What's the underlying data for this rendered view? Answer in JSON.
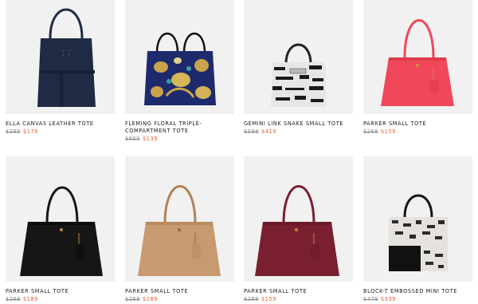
{
  "products": [
    {
      "name": "ELLA CANVAS LEATHER TOTE",
      "original_price": "$295",
      "sale_price": "$179",
      "icon": "navy-tote-bag-icon"
    },
    {
      "name": "FLEMING FLORAL TRIPLE-COMPARTMENT TOTE",
      "original_price": "$650",
      "sale_price": "$139",
      "icon": "floral-tote-bag-icon"
    },
    {
      "name": "GEMINI LINK SNAKE SMALL TOTE",
      "original_price": "$598",
      "sale_price": "$419",
      "icon": "snake-print-tote-bag-icon"
    },
    {
      "name": "PARKER SMALL TOTE",
      "original_price": "$268",
      "sale_price": "$159",
      "icon": "coral-tote-bag-icon"
    },
    {
      "name": "PARKER SMALL TOTE",
      "original_price": "$268",
      "sale_price": "$189",
      "icon": "black-tote-bag-icon"
    },
    {
      "name": "PARKER SMALL TOTE",
      "original_price": "$268",
      "sale_price": "$189",
      "icon": "tan-tote-bag-icon"
    },
    {
      "name": "PARKER SMALL TOTE",
      "original_price": "$268",
      "sale_price": "$159",
      "icon": "burgundy-tote-bag-icon"
    },
    {
      "name": "BLOCK-T EMBOSSED MINI TOTE",
      "original_price": "$478",
      "sale_price": "$339",
      "icon": "black-snake-block-tote-bag-icon"
    }
  ],
  "colors": {
    "sale": "#e8633a",
    "navy": "#1f2a44",
    "coral": "#f0475a",
    "black": "#161616",
    "tan": "#c79a6f",
    "burgundy": "#7a1f2f"
  }
}
